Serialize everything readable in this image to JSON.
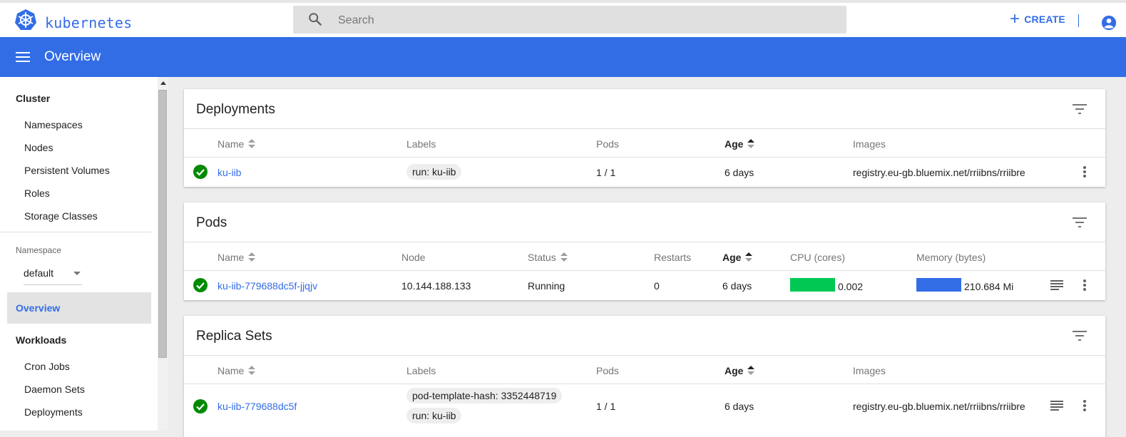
{
  "header": {
    "brand": "kubernetes",
    "search_placeholder": "Search",
    "create_label": "CREATE",
    "plus": "+"
  },
  "titlebar": {
    "title": "Overview"
  },
  "sidebar": {
    "cluster_heading": "Cluster",
    "cluster_items": [
      "Namespaces",
      "Nodes",
      "Persistent Volumes",
      "Roles",
      "Storage Classes"
    ],
    "namespace_label": "Namespace",
    "namespace_value": "default",
    "active_item": "Overview",
    "workloads_heading": "Workloads",
    "workload_items": [
      "Cron Jobs",
      "Daemon Sets",
      "Deployments"
    ]
  },
  "deployments": {
    "title": "Deployments",
    "headers": {
      "name": "Name",
      "labels": "Labels",
      "pods": "Pods",
      "age": "Age",
      "images": "Images"
    },
    "rows": [
      {
        "name": "ku-iib",
        "label": "run: ku-iib",
        "pods": "1 / 1",
        "age": "6 days",
        "image": "registry.eu-gb.bluemix.net/rriibns/rriibre"
      }
    ]
  },
  "pods": {
    "title": "Pods",
    "headers": {
      "name": "Name",
      "node": "Node",
      "status": "Status",
      "restarts": "Restarts",
      "age": "Age",
      "cpu": "CPU (cores)",
      "memory": "Memory (bytes)"
    },
    "rows": [
      {
        "name": "ku-iib-779688dc5f-jjqjv",
        "node": "10.144.188.133",
        "status": "Running",
        "restarts": "0",
        "age": "6 days",
        "cpu": "0.002",
        "memory": "210.684 Mi"
      }
    ]
  },
  "replica_sets": {
    "title": "Replica Sets",
    "headers": {
      "name": "Name",
      "labels": "Labels",
      "pods": "Pods",
      "age": "Age",
      "images": "Images"
    },
    "rows": [
      {
        "name": "ku-iib-779688dc5f",
        "labels": [
          "pod-template-hash: 3352448719",
          "run: ku-iib"
        ],
        "pods": "1 / 1",
        "age": "6 days",
        "image": "registry.eu-gb.bluemix.net/rriibns/rriibre"
      }
    ]
  },
  "colors": {
    "accent": "#326de6",
    "ok": "#008a00",
    "cpu_bar": "#00c853",
    "memory_bar": "#326de6"
  },
  "icons": [
    "kubernetes-logo-icon",
    "search-icon",
    "plus-icon",
    "account-icon",
    "menu-icon",
    "filter-icon",
    "check-circle-icon",
    "kebab-icon",
    "logs-icon"
  ]
}
